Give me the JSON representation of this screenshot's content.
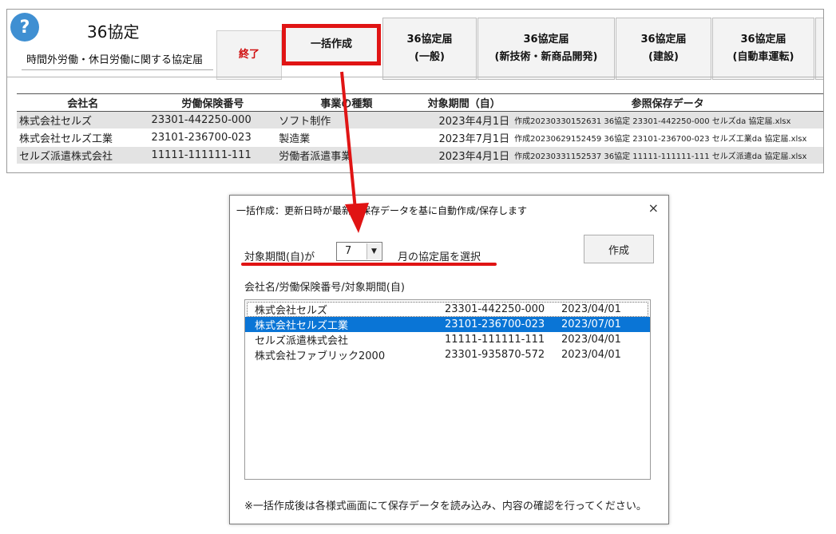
{
  "header": {
    "help_icon": "?",
    "title": "36協定",
    "subtitle": "時間外労働・休日労働に関する協定届"
  },
  "toolbar": {
    "exit_label": "終了",
    "bulk_label": "一括作成",
    "buttons": [
      {
        "line1": "36協定届",
        "line2": "(一般)"
      },
      {
        "line1": "36協定届",
        "line2": "(新技術・新商品開発)"
      },
      {
        "line1": "36協定届",
        "line2": "(建設)"
      },
      {
        "line1": "36協定届",
        "line2": "(自動車運転)"
      }
    ]
  },
  "table": {
    "headers": [
      "会社名",
      "労働保険番号",
      "事業の種類",
      "対象期間（自）",
      "参照保存データ"
    ],
    "rows": [
      [
        "株式会社セルズ",
        "23301-442250-000",
        "ソフト制作",
        "2023年4月1日",
        "作成20230330152631 36協定 23301-442250-000 セルズda 協定届.xlsx"
      ],
      [
        "株式会社セルズ工業",
        "23101-236700-023",
        "製造業",
        "2023年7月1日",
        "作成20230629152459 36協定 23101-236700-023 セルズ工業da 協定届.xlsx"
      ],
      [
        "セルズ派遣株式会社",
        "11111-111111-111",
        "労働者派遣事業",
        "2023年4月1日",
        "作成20230331152537 36協定 11111-111111-111 セルズ派遣da 協定届.xlsx"
      ]
    ]
  },
  "dialog": {
    "title": "一括作成：更新日時が最新の保存データを基に自動作成/保存します",
    "close": "×",
    "period_label": "対象期間(自)が",
    "month_value": "7",
    "month_suffix": "月の協定届を選択",
    "create_label": "作成",
    "list_label": "会社名/労働保険番号/対象期間(自)",
    "items": [
      {
        "name": "株式会社セルズ",
        "number": "23301-442250-000",
        "date": "2023/04/01"
      },
      {
        "name": "株式会社セルズ工業",
        "number": "23101-236700-023",
        "date": "2023/07/01"
      },
      {
        "name": "セルズ派遣株式会社",
        "number": "11111-111111-111",
        "date": "2023/04/01"
      },
      {
        "name": "株式会社ファブリック2000",
        "number": "23301-935870-572",
        "date": "2023/04/01"
      }
    ],
    "note": "※一括作成後は各様式画面にて保存データを読み込み、内容の確認を行ってください。"
  },
  "colors": {
    "accent_red": "#e01414",
    "selection_blue": "#0a75d6",
    "help_blue": "#3f8fd2"
  }
}
